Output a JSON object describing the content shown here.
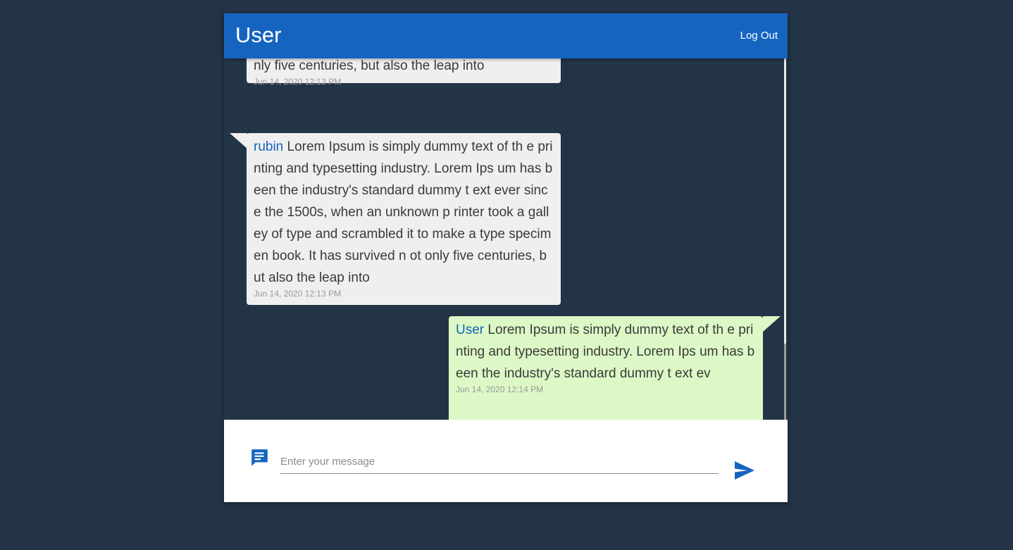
{
  "header": {
    "title": "User",
    "logout_label": "Log Out"
  },
  "messages": [
    {
      "sender": "",
      "text": "make a type specimen book. It has survived n ot only five centuries, but also the leap into",
      "time": "Jun 14, 2020 12:13 PM",
      "side": "received"
    },
    {
      "sender": "rubin",
      "text": "Lorem Ipsum is simply dummy text of th e printing and typesetting industry. Lorem Ips um has been the industry's standard dummy t ext ever since the 1500s, when an unknown p rinter took a galley of type and scrambled it to make a type specimen book. It has survived n ot only five centuries, but also the leap into",
      "time": "Jun 14, 2020 12:13 PM",
      "side": "received"
    },
    {
      "sender": "User",
      "text": "Lorem Ipsum is simply dummy text of th e printing and typesetting industry. Lorem Ips um has been the industry's standard dummy t ext ev",
      "time": "Jun 14, 2020 12:14 PM",
      "side": "sent"
    }
  ],
  "composer": {
    "placeholder": "Enter your message",
    "value": "",
    "chat_icon": "chat-message-icon",
    "send_icon": "send-icon"
  },
  "colors": {
    "background": "#233447",
    "app_bar": "#1565c0",
    "received_bubble": "#efefef",
    "sent_bubble": "#dcf8c6",
    "sender_name": "#1565c0"
  }
}
